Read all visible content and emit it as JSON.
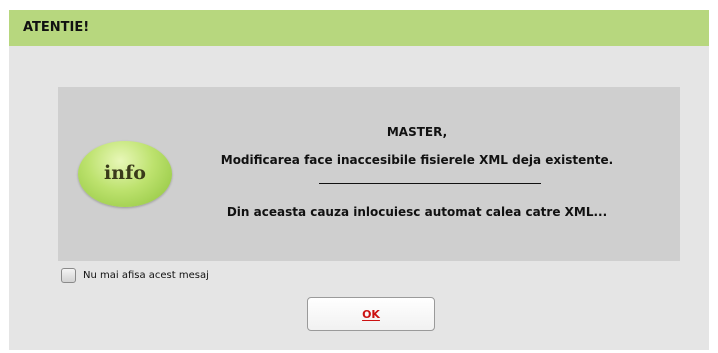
{
  "dialog": {
    "title": "ATENTIE!",
    "icon": "info-badge-icon",
    "icon_text": "info",
    "message": {
      "line1": "MASTER,",
      "line2": "Modificarea face inaccesibile fisierele XML deja existente.",
      "line3": "Din aceasta cauza inlocuiesc automat calea catre XML..."
    },
    "checkbox": {
      "label": "Nu mai afisa acest mesaj",
      "checked": false
    },
    "ok_button": {
      "label": "OK"
    }
  },
  "colors": {
    "titlebar": "#b7d77e",
    "dialog_bg": "#e5e5e5",
    "panel_bg": "#cfcfcf",
    "ok_text": "#cc1111"
  }
}
